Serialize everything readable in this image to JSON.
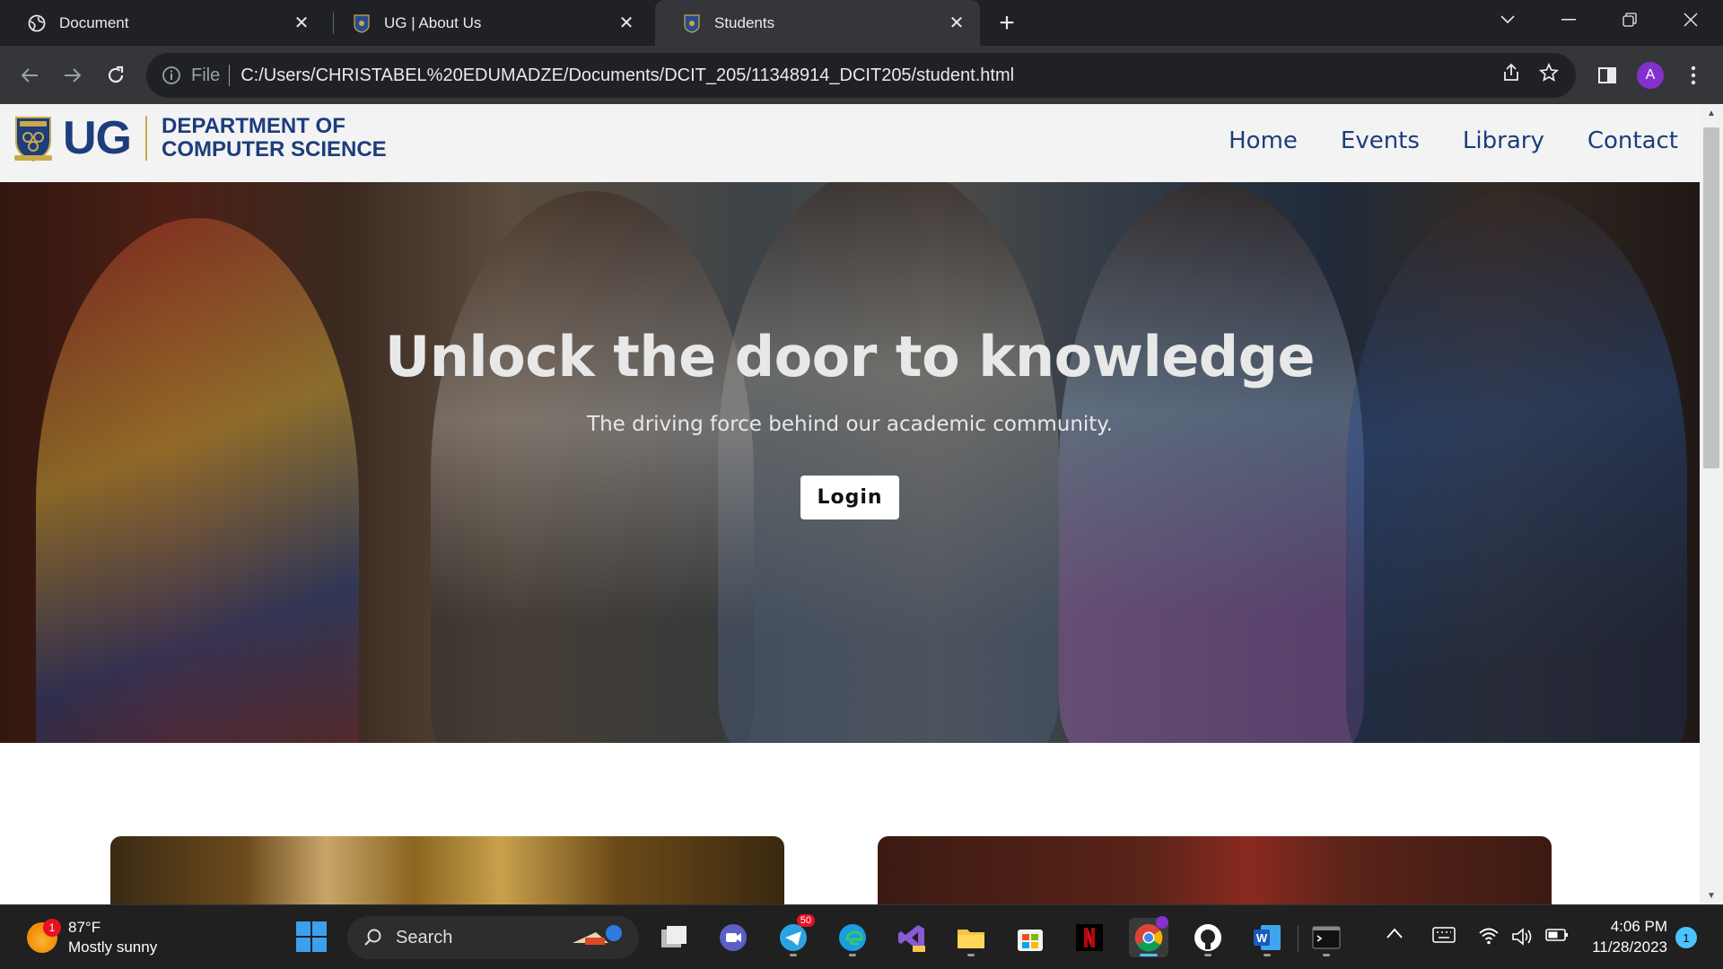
{
  "browser": {
    "tabs": [
      {
        "title": "Document",
        "icon": "globe-icon",
        "active": false
      },
      {
        "title": "UG | About Us",
        "icon": "ug-crest-icon",
        "active": false
      },
      {
        "title": "Students",
        "icon": "ug-crest-icon",
        "active": true
      }
    ],
    "address": {
      "scheme": "File",
      "url": "C:/Users/CHRISTABEL%20EDUMADZE/Documents/DCIT_205/11348914_DCIT205/student.html"
    },
    "profile_initial": "A"
  },
  "site": {
    "logo_text": "UG",
    "department_line1": "DEPARTMENT OF",
    "department_line2": "COMPUTER SCIENCE",
    "nav": [
      "Home",
      "Events",
      "Library",
      "Contact"
    ],
    "hero": {
      "heading": "Unlock the door to knowledge",
      "subheading": "The driving force behind our academic community.",
      "button": "Login"
    },
    "colors": {
      "brand": "#1d3d7c",
      "gold": "#c9a948"
    }
  },
  "taskbar": {
    "weather": {
      "temp": "87°F",
      "condition": "Mostly sunny",
      "badge": "1"
    },
    "search_label": "Search",
    "telegram_badge": "50",
    "clock": {
      "time": "4:06 PM",
      "date": "11/28/2023"
    },
    "notifications": "1"
  }
}
